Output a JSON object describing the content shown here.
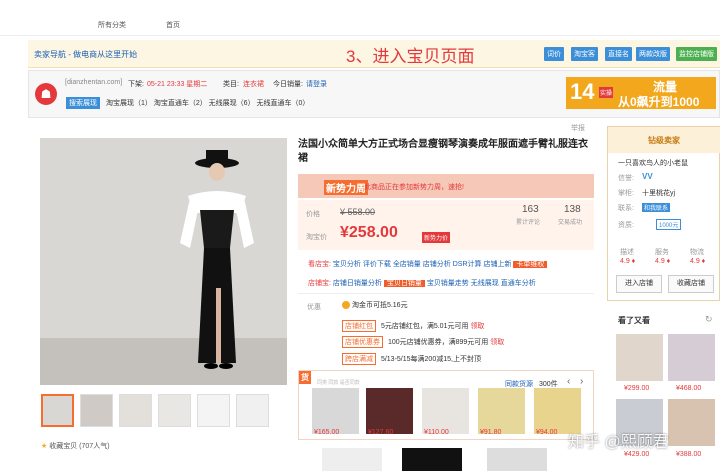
{
  "top_nav": {
    "items": [
      "所有分类",
      "首页"
    ]
  },
  "seller_bar": {
    "title": "卖家导航 - 做电商从这里开始",
    "step_title": "3、进入宝贝页面",
    "buttons": [
      "词价",
      "淘宝客",
      "直接名",
      "两款改版",
      "监控店铺版"
    ]
  },
  "info": {
    "site": "[dianzhentan.com]",
    "update_label": "下架:",
    "update_value": "05-21 23:33 星期二",
    "cat_label": "类目:",
    "cat_value": "连衣裙",
    "sales_label": "今日销量:",
    "sales_value": "请登录",
    "tag": "搜索展现",
    "line2": "淘宝展现（1） 淘宝直通车（2） 无线展现（6） 无线直通车（0）"
  },
  "banner": {
    "num": "14",
    "sub": "实操",
    "text1": "流量",
    "text2": "从0飙升到1000"
  },
  "product": {
    "title": "法国小众简单大方正式场合显瘦钢琴演奏成年服面遮手臂礼服连衣裙",
    "promo_tag": "新势力周",
    "promo_text": "此商品正在参加新势力周，速抢!",
    "price_label": "价格",
    "price_orig": "¥ 558.00",
    "tb_price_label": "淘宝价",
    "tb_price": "¥258.00",
    "tb_price_badge": "新势力价",
    "stat1_num": "163",
    "stat1_label": "累计评论",
    "stat2_num": "138",
    "stat2_label": "交易成功",
    "analysis_row1": [
      "看店宝:",
      "宝贝分析",
      "评价下载",
      "全店销量",
      "店铺分析",
      "DSR计算",
      "店铺上新",
      "卡单维权"
    ],
    "analysis_row2": [
      "店铺宝:",
      "店铺日销量分析",
      "宝贝日销量",
      "宝贝销量走势",
      "无线展现",
      "直通车分析"
    ],
    "promo_label": "优惠",
    "coin": "淘金币可抵5.16元",
    "coupons": [
      {
        "tag": "店铺红包",
        "text": "5元店铺红包，满5.01元可用",
        "link": "领取"
      },
      {
        "tag": "店铺优惠券",
        "text": "100元店铺优惠券，满899元可用",
        "link": "领取"
      },
      {
        "tag": "跨店满减",
        "text": "5/13-5/15每满200减15,上不封顶",
        "link": ""
      }
    ],
    "fav": "收藏宝贝 (707人气)",
    "cart_label": "举报"
  },
  "similar": {
    "tag": "货",
    "title": "同类 同款 是否同款",
    "source": "同款货源",
    "count": "300件",
    "nav_prev": "‹",
    "nav_next": "›",
    "prices": [
      "¥165.00",
      "¥127.60",
      "¥110.00",
      "¥91.80",
      "¥94.00"
    ]
  },
  "shop": {
    "level": "钻级卖家",
    "name": "一只喜欢鸟人的小老鼠",
    "rating_label": "信誉:",
    "rating_value": "VV",
    "keeper_label": "掌柜:",
    "keeper_value": "十里桃花yj",
    "contact_label": "联系:",
    "contact_value": "和我联系",
    "qual_label": "资质:",
    "qual_value": "1000元",
    "scores": [
      {
        "label": "描述",
        "value": "4.9 ♦"
      },
      {
        "label": "服务",
        "value": "4.9 ♦"
      },
      {
        "label": "物流",
        "value": "4.9 ♦"
      }
    ],
    "btn_enter": "进入店铺",
    "btn_fav": "收藏店铺",
    "seen_title": "看了又看",
    "seen_prices": [
      "¥299.00",
      "¥468.00",
      "¥429.00",
      "¥388.00"
    ]
  },
  "watermark": "知乎 @熙顾君",
  "colors": {
    "accent_orange": "#f56d2f",
    "price_red": "#e4393c",
    "link_blue": "#1a5fb4",
    "btn_blue": "#3b8fd8"
  }
}
